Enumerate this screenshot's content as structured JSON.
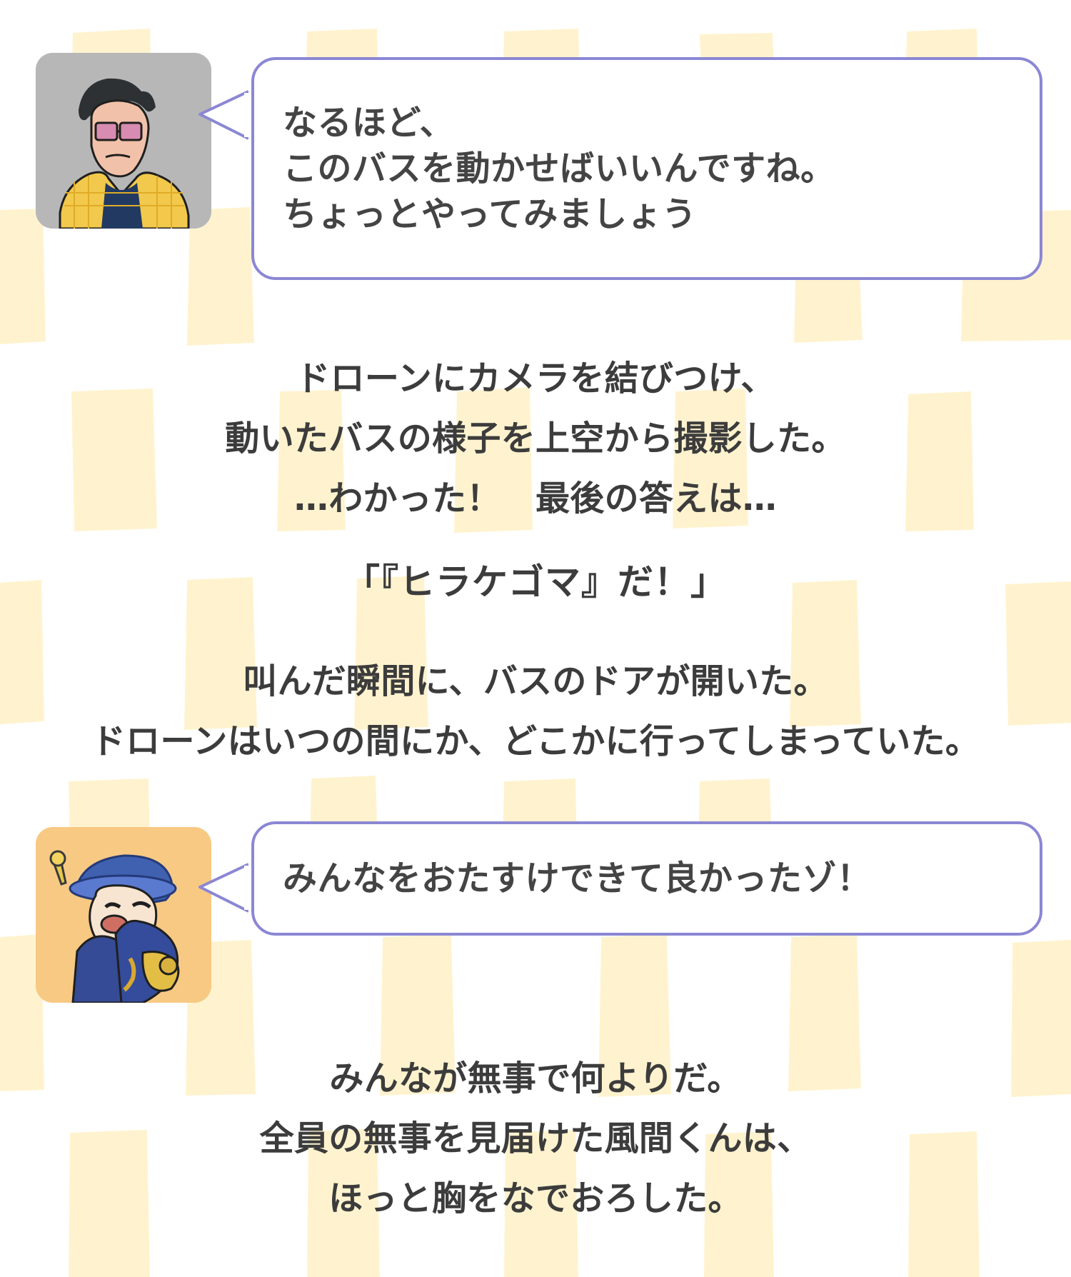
{
  "dialogue": [
    {
      "speaker_icon": "old-man-icon",
      "text": "なるほど、\nこのバスを動かせばいいんですね。\nちょっとやってみましょう"
    },
    {
      "speaker_icon": "shinchan-icon",
      "text": "みんなをおたすけできて良かったゾ！"
    }
  ],
  "narration": [
    "ドローンにカメラを結びつけ、\n動いたバスの様子を上空から撮影した。\n…わかった！　最後の答えは…",
    "「『ヒラケゴマ』だ！」",
    "叫んだ瞬間に、バスのドアが開いた。\nドローンはいつの間にか、どこかに行ってしまっていた。",
    "みんなが無事で何よりだ。\n全員の無事を見届けた風間くんは、\nほっと胸をなでおろした。"
  ],
  "theme": {
    "bubble_border": "#8b87d4",
    "pattern_color": "#fff3cf",
    "text_color": "#3c3c3c"
  }
}
